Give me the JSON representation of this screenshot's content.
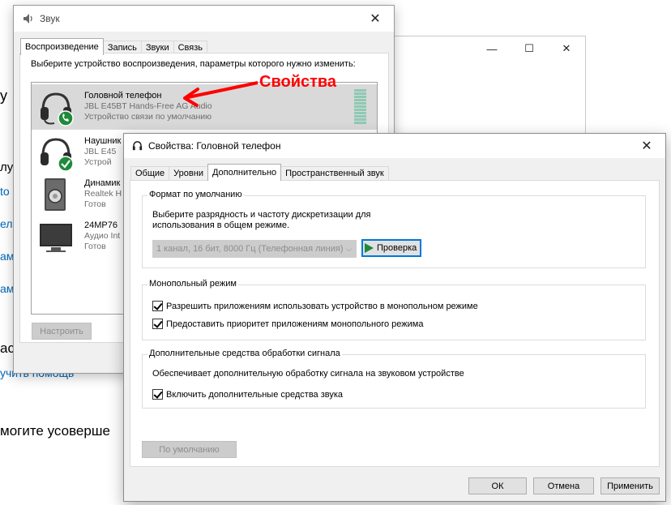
{
  "background_settings": {
    "fragments": [
      "у",
      "лу",
      "tо",
      "ел",
      "ам",
      "ам",
      "ас",
      "учить помощь",
      "могите усоверше"
    ]
  },
  "sound_dialog": {
    "title": "Звук",
    "tabs": [
      "Воспроизведение",
      "Запись",
      "Звуки",
      "Связь"
    ],
    "active_tab": "Воспроизведение",
    "instruction": "Выберите устройство воспроизведения, параметры которого нужно изменить:",
    "devices": [
      {
        "name": "Головной телефон",
        "driver": "JBL E45BT Hands-Free AG Audio",
        "status": "Устройство связи по умолчанию",
        "icon": "headset-phone-icon",
        "selected": true
      },
      {
        "name": "Наушник",
        "driver": "JBL E45",
        "status": "Устрой",
        "icon": "headphones-check-icon",
        "selected": false
      },
      {
        "name": "Динамик",
        "driver": "Realtek H",
        "status": "Готов",
        "icon": "speaker-icon",
        "selected": false
      },
      {
        "name": "24MP76",
        "driver": "Аудио Int",
        "status": "Готов",
        "icon": "monitor-icon",
        "selected": false
      }
    ],
    "configure_button": "Настроить"
  },
  "annotation": {
    "label": "Свойства",
    "color": "#ff0000"
  },
  "properties_dialog": {
    "title": "Свойства: Головной телефон",
    "tabs": [
      "Общие",
      "Уровни",
      "Дополнительно",
      "Пространственный звук"
    ],
    "active_tab": "Дополнительно",
    "default_format": {
      "title": "Формат по умолчанию",
      "description": "Выберите разрядность и частоту дискретизации для использования в общем режиме.",
      "format_value": "1 канал, 16 бит, 8000 Гц (Телефонная линия)",
      "test_button": "Проверка"
    },
    "exclusive_mode": {
      "title": "Монопольный режим",
      "options": [
        {
          "label": "Разрешить приложениям использовать устройство в монопольном режиме",
          "checked": true
        },
        {
          "label": "Предоставить приоритет приложениям монопольного режима",
          "checked": true
        }
      ]
    },
    "enhancements": {
      "title": "Дополнительные средства обработки сигнала",
      "description": "Обеспечивает дополнительную обработку сигнала на звуковом устройстве",
      "option": {
        "label": "Включить дополнительные средства звука",
        "checked": true
      }
    },
    "restore_defaults_button": "По умолчанию",
    "ok_button": "ОК",
    "cancel_button": "Отмена",
    "apply_button": "Применить"
  },
  "colors": {
    "link": "#0067b8",
    "accent": "#0078d7",
    "selection": "#d9d9d9",
    "check_green": "#1f8a3a"
  }
}
